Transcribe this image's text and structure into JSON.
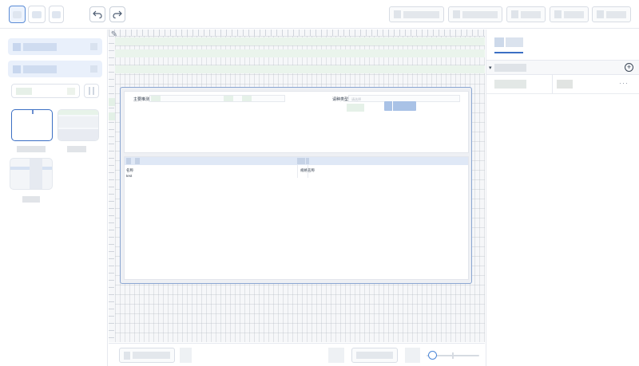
{
  "toolbar": {
    "undo_icon": "undo-icon",
    "redo_icon": "redo-icon"
  },
  "canvas": {
    "form": {
      "field1_label": "主要推测",
      "field2_label": "请种类型",
      "field2_placeholder": "请选择"
    },
    "table": {
      "col1_header": "名称",
      "col1_value": "test",
      "col2_header": "规格名称"
    }
  },
  "right_panel": {
    "section_caret": "▾",
    "add_icon": "plus-circle-icon",
    "more_icon": "ellipsis-icon",
    "more_text": "···"
  },
  "colors": {
    "accent": "#3b6fc4",
    "selection_border": "#8aa6d2",
    "primary_button": "#a9c2e6"
  }
}
